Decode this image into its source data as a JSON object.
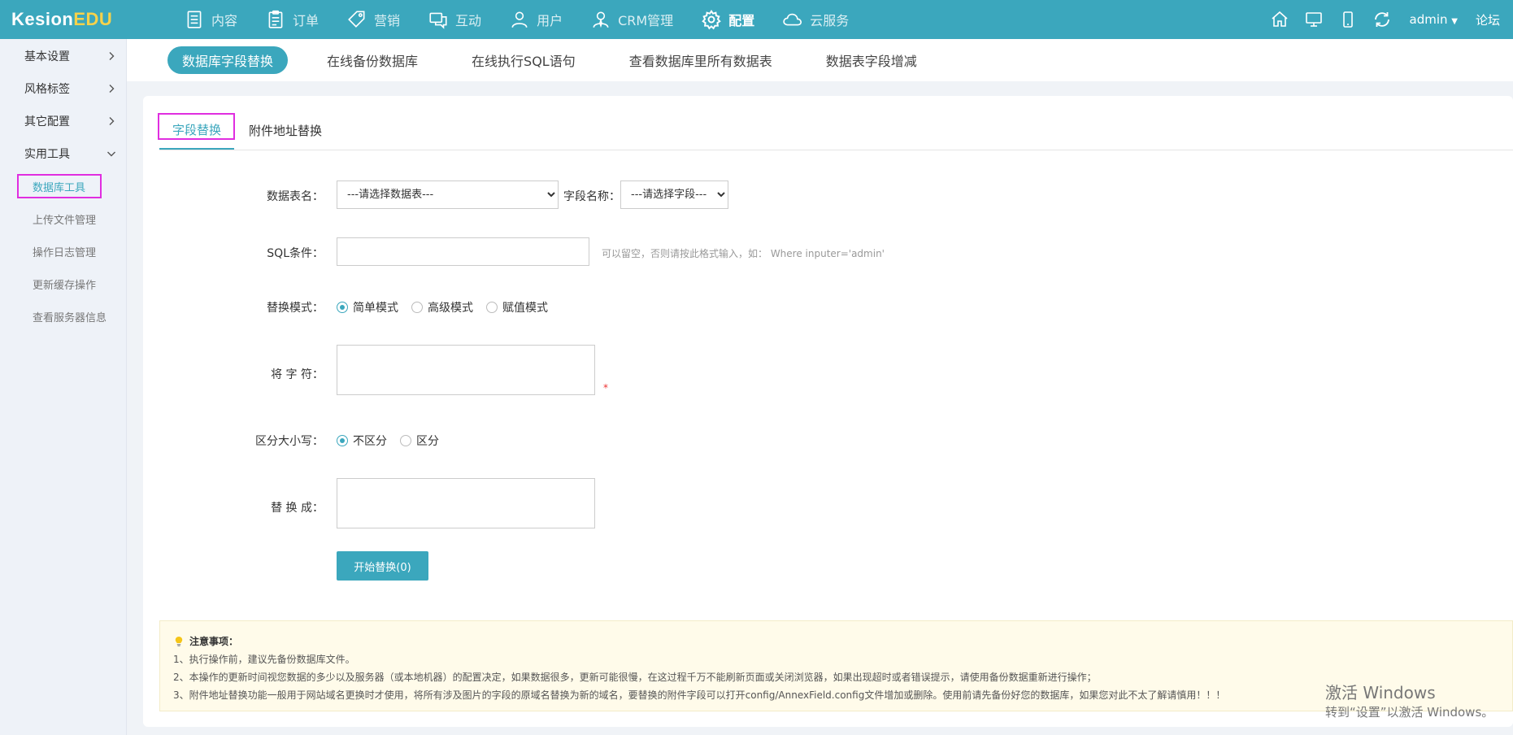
{
  "brand": {
    "part1": "Kesion",
    "part2": "EDU"
  },
  "topnav": [
    {
      "label": "内容",
      "icon": "document-icon"
    },
    {
      "label": "订单",
      "icon": "clipboard-icon"
    },
    {
      "label": "营销",
      "icon": "tag-icon"
    },
    {
      "label": "互动",
      "icon": "chat-icon"
    },
    {
      "label": "用户",
      "icon": "user-icon"
    },
    {
      "label": "CRM管理",
      "icon": "crm-user-icon"
    },
    {
      "label": "配置",
      "icon": "gear-icon"
    },
    {
      "label": "云服务",
      "icon": "cloud-icon"
    }
  ],
  "topright": {
    "user": "admin",
    "forum": "论坛"
  },
  "sidebar": {
    "groups": [
      "基本设置",
      "风格标签",
      "其它配置",
      "实用工具"
    ],
    "subitems": [
      "数据库工具",
      "上传文件管理",
      "操作日志管理",
      "更新缓存操作",
      "查看服务器信息"
    ]
  },
  "subtabs": [
    "数据库字段替换",
    "在线备份数据库",
    "在线执行SQL语句",
    "查看数据库里所有数据表",
    "数据表字段增减"
  ],
  "inner_tabs": [
    "字段替换",
    "附件地址替换"
  ],
  "form": {
    "table_label": "数据表名：",
    "table_select": "---请选择数据表---",
    "field_label": "字段名称：",
    "field_select": "---请选择字段---",
    "sql_label": "SQL条件：",
    "sql_value": "",
    "sql_hint": "可以留空，否则请按此格式输入，如： Where inputer='admin'",
    "mode_label": "替换模式：",
    "modes": [
      "简单模式",
      "高级模式",
      "赋值模式"
    ],
    "from_label": "将 字 符：",
    "required_mark": "*",
    "case_label": "区分大小写：",
    "case_options": [
      "不区分",
      "区分"
    ],
    "to_label": "替 换 成：",
    "submit": "开始替换(0)"
  },
  "notes": {
    "title": "注意事项：",
    "lines": [
      "1、执行操作前，建议先备份数据库文件。",
      "2、本操作的更新时间视您数据的多少以及服务器（或本地机器）的配置决定，如果数据很多，更新可能很慢，在这过程千万不能刷新页面或关闭浏览器，如果出现超时或者错误提示，请使用备份数据重新进行操作；",
      "3、附件地址替换功能一般用于网站域名更换时才使用，将所有涉及图片的字段的原域名替换为新的域名，要替换的附件字段可以打开config/AnnexField.config文件增加或删除。使用前请先备份好您的数据库，如果您对此不太了解请慎用！！！"
    ]
  },
  "watermark": {
    "line1": "激活 Windows",
    "line2": "转到“设置”以激活 Windows。"
  }
}
